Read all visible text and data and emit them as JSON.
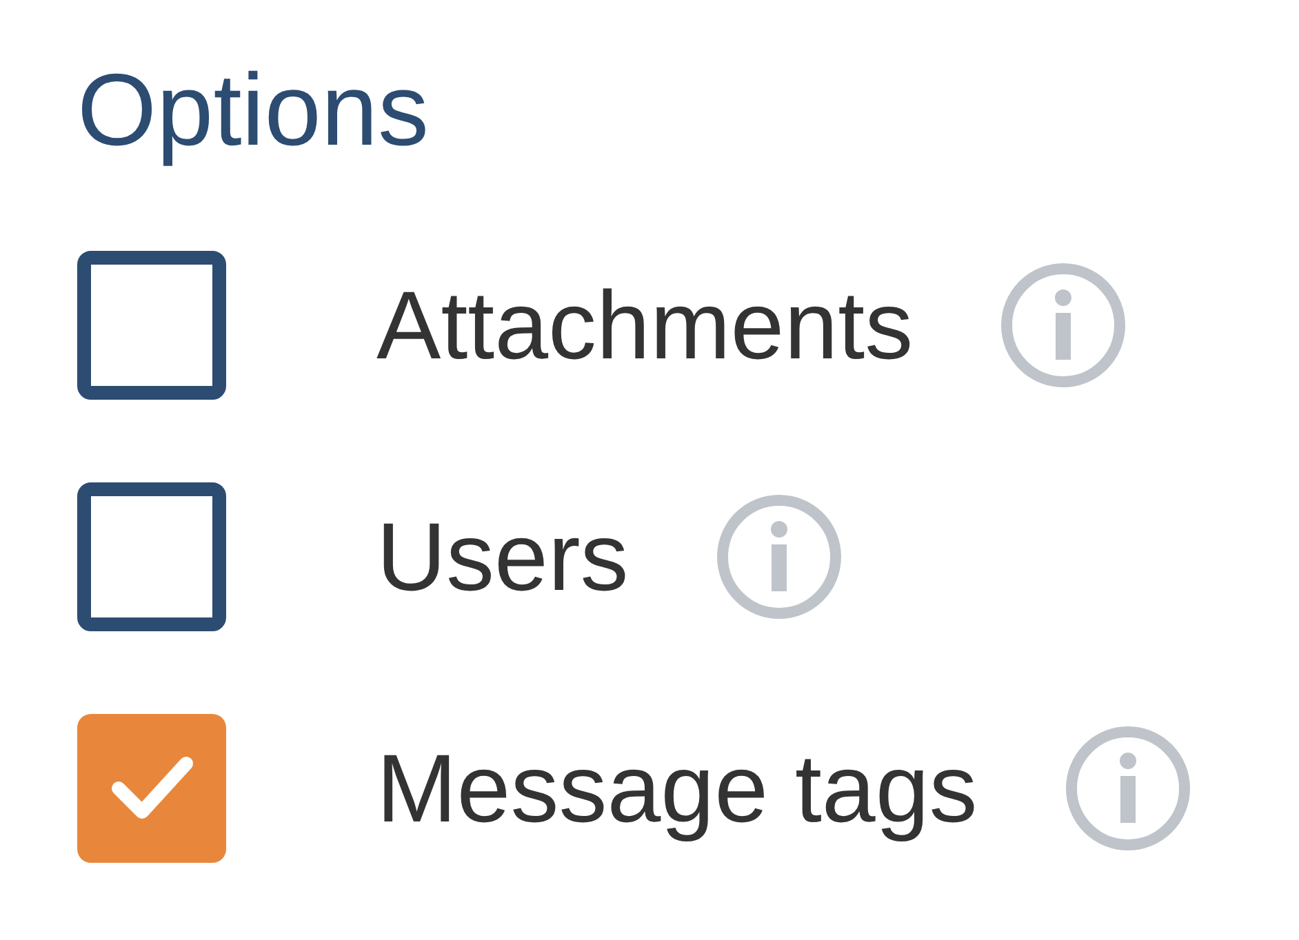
{
  "title": "Options",
  "options": [
    {
      "label": "Attachments",
      "checked": false
    },
    {
      "label": "Users",
      "checked": false
    },
    {
      "label": "Message tags",
      "checked": true
    }
  ]
}
